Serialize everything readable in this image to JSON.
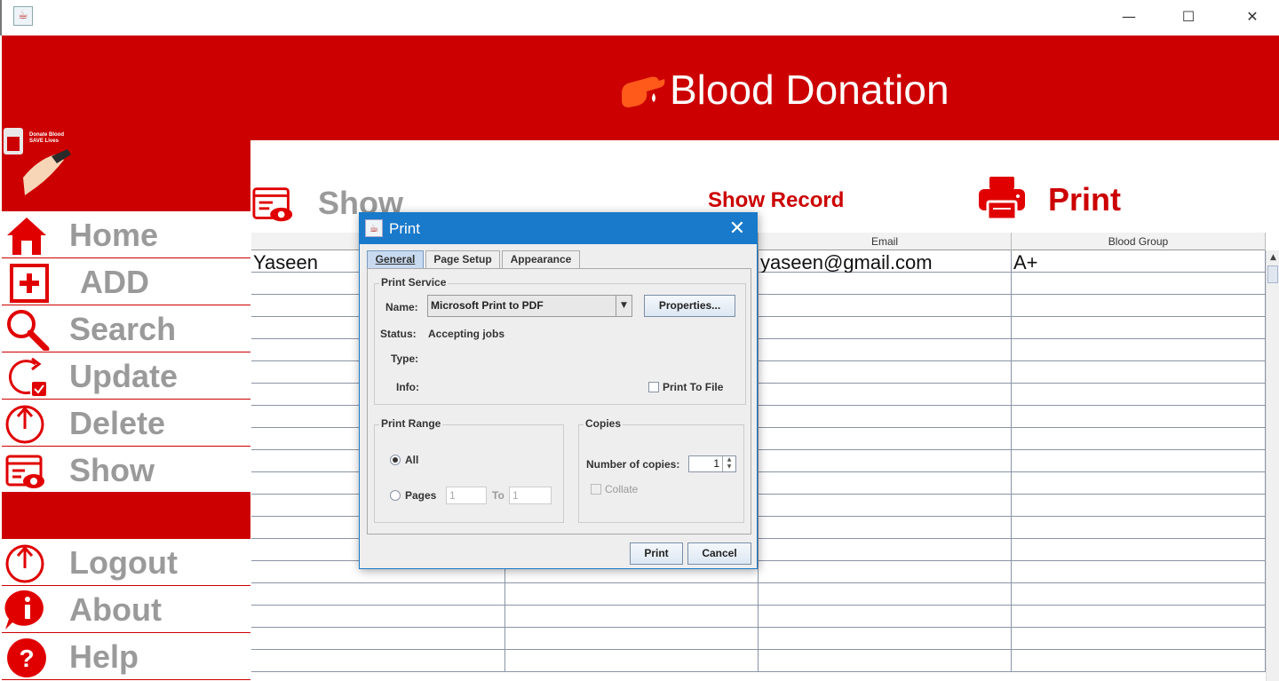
{
  "window": {
    "minimize_glyph": "—",
    "maximize_glyph": "☐",
    "close_glyph": "✕"
  },
  "header": {
    "title": "Blood Donation",
    "icon": "blood-drop-hand-icon"
  },
  "sidebar": {
    "logo": {
      "line1": "Donate Blood",
      "line2": "SAVE Lives"
    },
    "items": [
      {
        "label": "Home",
        "icon": "home-icon"
      },
      {
        "label": "ADD",
        "icon": "plus-icon"
      },
      {
        "label": "Search",
        "icon": "search-icon"
      },
      {
        "label": "Update",
        "icon": "update-icon"
      },
      {
        "label": "Delete",
        "icon": "power-icon"
      },
      {
        "label": "Show",
        "icon": "show-record-icon"
      },
      {
        "label": "Logout",
        "icon": "logout-icon"
      },
      {
        "label": "About",
        "icon": "info-icon"
      },
      {
        "label": "Help",
        "icon": "help-icon"
      }
    ]
  },
  "main": {
    "show_title": "Show",
    "show_record_label": "Show Record",
    "print_label": "Print",
    "table": {
      "columns": [
        "",
        "",
        "Email",
        "Blood Group"
      ],
      "rows": [
        [
          "Yaseen",
          "",
          "yaseen@gmail.com",
          "A+"
        ]
      ]
    }
  },
  "print_dialog": {
    "title": "Print",
    "close_glyph": "✕",
    "tabs": [
      "General",
      "Page Setup",
      "Appearance"
    ],
    "active_tab": "General",
    "print_service": {
      "group_title": "Print Service",
      "name_label": "Name:",
      "name_value": "Microsoft Print to PDF",
      "properties_button": "Properties...",
      "status_label": "Status:",
      "status_value": "Accepting jobs",
      "type_label": "Type:",
      "info_label": "Info:",
      "print_to_file_label": "Print To File"
    },
    "print_range": {
      "group_title": "Print Range",
      "all_label": "All",
      "pages_label": "Pages",
      "from_value": "1",
      "to_label": "To",
      "to_value": "1"
    },
    "copies": {
      "group_title": "Copies",
      "number_label": "Number of copies:",
      "number_value": "1",
      "collate_label": "Collate"
    },
    "print_button": "Print",
    "cancel_button": "Cancel"
  },
  "colors": {
    "brand_red": "#cc0000",
    "dialog_blue": "#1979ca",
    "nav_gray": "#9a9a9a"
  }
}
